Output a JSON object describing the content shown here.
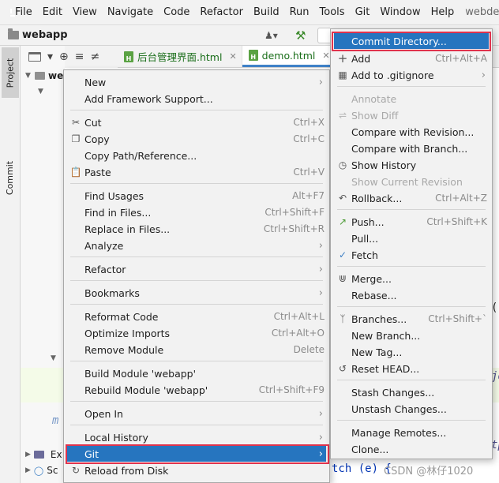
{
  "menubar": {
    "items": [
      "File",
      "Edit",
      "View",
      "Navigate",
      "Code",
      "Refactor",
      "Build",
      "Run",
      "Tools",
      "Git",
      "Window",
      "Help"
    ],
    "window_title": "webdemo"
  },
  "toolbar": {
    "project_name": "webapp"
  },
  "left_strip": {
    "project_tab": "Project",
    "commit_tab": "Commit"
  },
  "project_tree": {
    "root": "we",
    "bottom1": "Ex",
    "bottom2": "Sc"
  },
  "tabs": [
    {
      "label": "后台管理界面.html"
    },
    {
      "label": "demo.html"
    }
  ],
  "code": {
    "frag1": "(",
    "frag2": "jo",
    "frag3": "tp",
    "frag4": "m",
    "frag5": "tch (e) {"
  },
  "watermark": "CSDN @林仔1020",
  "context_menu": {
    "new": {
      "label": "New"
    },
    "add_framework": {
      "label": "Add Framework Support..."
    },
    "cut": {
      "label": "Cut",
      "shortcut": "Ctrl+X"
    },
    "copy": {
      "label": "Copy",
      "shortcut": "Ctrl+C"
    },
    "copy_path": {
      "label": "Copy Path/Reference..."
    },
    "paste": {
      "label": "Paste",
      "shortcut": "Ctrl+V"
    },
    "find_usages": {
      "label": "Find Usages",
      "shortcut": "Alt+F7"
    },
    "find_in_files": {
      "label": "Find in Files...",
      "shortcut": "Ctrl+Shift+F"
    },
    "replace_in_files": {
      "label": "Replace in Files...",
      "shortcut": "Ctrl+Shift+R"
    },
    "analyze": {
      "label": "Analyze"
    },
    "refactor": {
      "label": "Refactor"
    },
    "bookmarks": {
      "label": "Bookmarks"
    },
    "reformat": {
      "label": "Reformat Code",
      "shortcut": "Ctrl+Alt+L"
    },
    "optimize": {
      "label": "Optimize Imports",
      "shortcut": "Ctrl+Alt+O"
    },
    "remove_module": {
      "label": "Remove Module",
      "shortcut": "Delete"
    },
    "build_module": {
      "label": "Build Module 'webapp'"
    },
    "rebuild_module": {
      "label": "Rebuild Module 'webapp'",
      "shortcut": "Ctrl+Shift+F9"
    },
    "open_in": {
      "label": "Open In"
    },
    "local_history": {
      "label": "Local History"
    },
    "git": {
      "label": "Git"
    },
    "reload": {
      "label": "Reload from Disk"
    }
  },
  "git_submenu": {
    "commit_directory": {
      "label": "Commit Directory..."
    },
    "add": {
      "label": "Add",
      "shortcut": "Ctrl+Alt+A"
    },
    "add_gitignore": {
      "label": "Add to .gitignore"
    },
    "annotate": {
      "label": "Annotate"
    },
    "show_diff": {
      "label": "Show Diff"
    },
    "compare_revision": {
      "label": "Compare with Revision..."
    },
    "compare_branch": {
      "label": "Compare with Branch..."
    },
    "show_history": {
      "label": "Show History"
    },
    "show_current_revision": {
      "label": "Show Current Revision"
    },
    "rollback": {
      "label": "Rollback...",
      "shortcut": "Ctrl+Alt+Z"
    },
    "push": {
      "label": "Push...",
      "shortcut": "Ctrl+Shift+K"
    },
    "pull": {
      "label": "Pull..."
    },
    "fetch": {
      "label": "Fetch"
    },
    "merge": {
      "label": "Merge..."
    },
    "rebase": {
      "label": "Rebase..."
    },
    "branches": {
      "label": "Branches...",
      "shortcut": "Ctrl+Shift+`"
    },
    "new_branch": {
      "label": "New Branch..."
    },
    "new_tag": {
      "label": "New Tag..."
    },
    "reset_head": {
      "label": "Reset HEAD..."
    },
    "stash": {
      "label": "Stash Changes..."
    },
    "unstash": {
      "label": "Unstash Changes..."
    },
    "manage_remotes": {
      "label": "Manage Remotes..."
    },
    "clone": {
      "label": "Clone..."
    }
  },
  "colors": {
    "selection": "#2675bf",
    "highlight_box": "#e0334d",
    "menu_bg": "#f2f2f2"
  }
}
